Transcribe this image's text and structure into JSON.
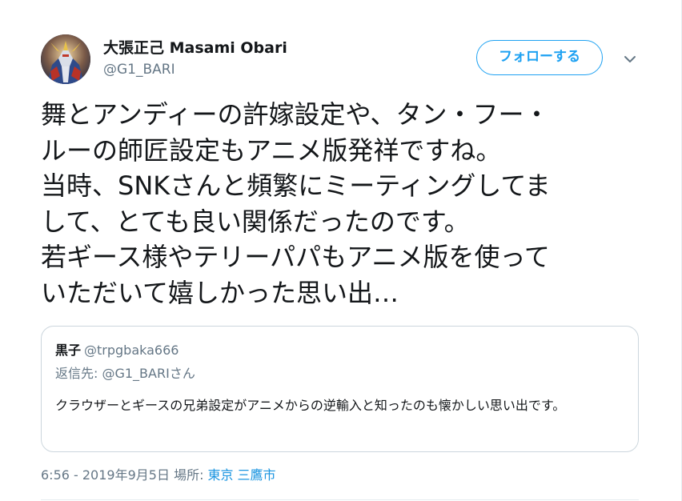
{
  "tweet": {
    "display_name": "大張正己 Masami Obari",
    "screen_name": "@G1_BARI",
    "follow_label": "フォローする",
    "text": "舞とアンディーの許嫁設定や、タン・フー・\nルーの師匠設定もアニメ版発祥ですね。\n当時、SNKさんと頻繁にミーティングしてま\nして、とても良い関係だったのです。\n若ギース様やテリーパパもアニメ版を使って\nいただいて嬉しかった思い出…",
    "timestamp": "6:56 - 2019年9月5日",
    "location_label": "場所:",
    "location": "東京 三鷹市"
  },
  "quote": {
    "name": "黒子",
    "handle": "@trpgbaka666",
    "reply_to": "返信先: @G1_BARIさん",
    "text": "クラウザーとギースの兄弟設定がアニメからの逆輸入と知ったのも懐かしい思い出です。"
  },
  "colors": {
    "accent": "#1da1f2",
    "link": "#1b95e0",
    "secondary_text": "#657786",
    "border": "#ccd6dd"
  },
  "icons": {
    "avatar": "robot-mecha-avatar",
    "caret": "chevron-down-icon"
  }
}
